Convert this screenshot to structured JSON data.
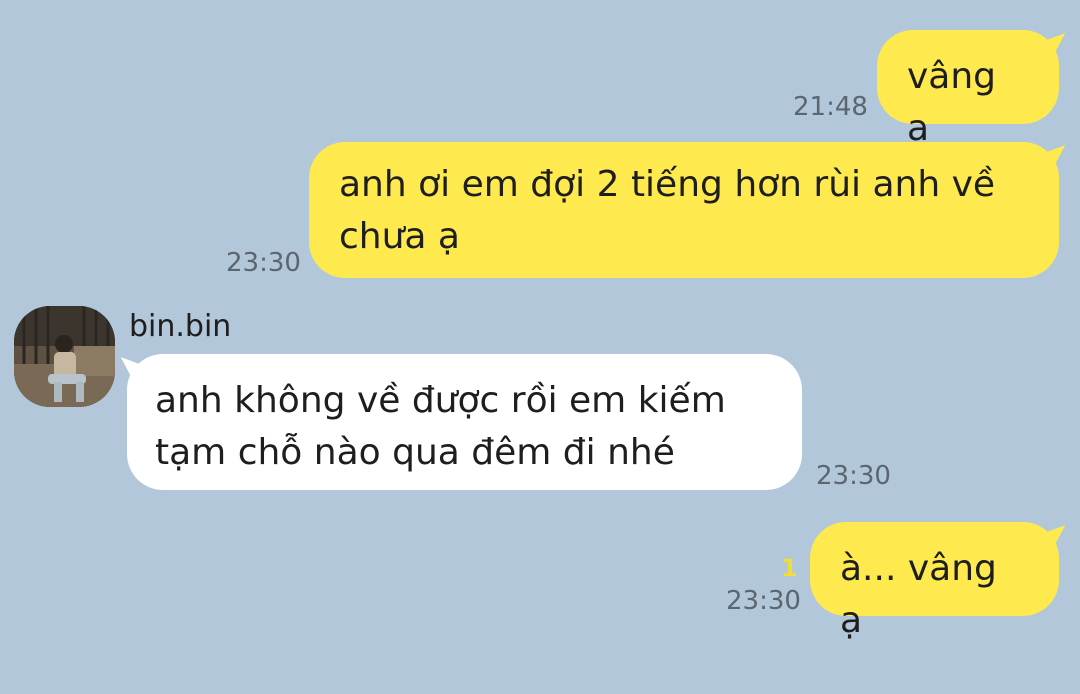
{
  "messages": [
    {
      "sender": "me",
      "text": "vâng ạ",
      "time": "21:48"
    },
    {
      "sender": "me",
      "text": "anh ơi em đợi 2 tiếng hơn rùi anh về\nchưa ạ",
      "time": "23:30"
    },
    {
      "sender": "other",
      "name": "bin.bin",
      "text": "anh không về được rồi em kiếm\ntạm chỗ nào qua đêm đi nhé",
      "time": "23:30"
    },
    {
      "sender": "me",
      "text": "à... vâng ạ",
      "time": "23:30",
      "unread": "1"
    }
  ],
  "colors": {
    "background": "#b2c7da",
    "my_bubble": "#fee94e",
    "other_bubble": "#ffffff",
    "timestamp": "#5c6670",
    "unread_badge": "#f2dc3c"
  },
  "icons": {
    "avatar": "profile-photo"
  }
}
